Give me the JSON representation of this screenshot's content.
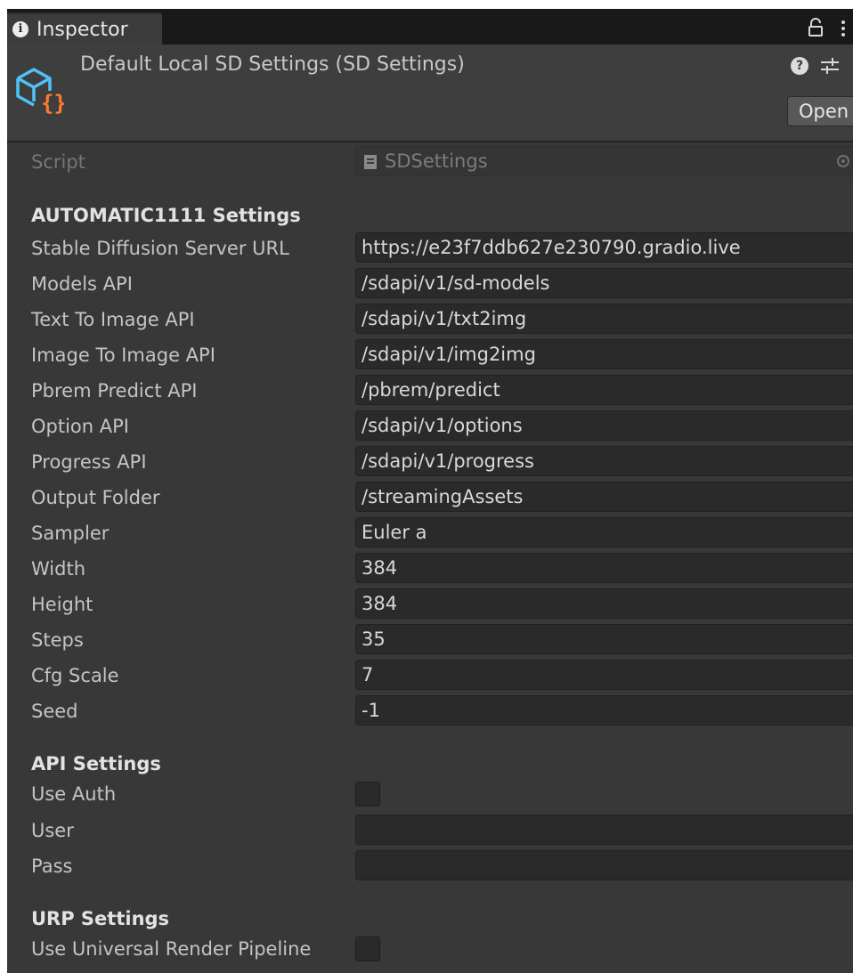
{
  "tab": {
    "title": "Inspector",
    "icon": "info-icon"
  },
  "header": {
    "title": "Default Local SD Settings (SD Settings)",
    "open_label": "Open",
    "icons": [
      "scriptable-object-icon",
      "help-icon",
      "preset-icon",
      "lock-icon",
      "kebab-menu-icon"
    ]
  },
  "script_row": {
    "label": "Script",
    "value": "SDSettings"
  },
  "automatic1111": {
    "header": "AUTOMATIC1111 Settings",
    "fields": [
      {
        "label": "Stable Diffusion Server URL",
        "value": "https://e23f7ddb627e230790.gradio.live"
      },
      {
        "label": "Models API",
        "value": "/sdapi/v1/sd-models"
      },
      {
        "label": "Text To Image API",
        "value": "/sdapi/v1/txt2img"
      },
      {
        "label": "Image To Image API",
        "value": "/sdapi/v1/img2img"
      },
      {
        "label": "Pbrem Predict API",
        "value": "/pbrem/predict"
      },
      {
        "label": "Option API",
        "value": "/sdapi/v1/options"
      },
      {
        "label": "Progress API",
        "value": "/sdapi/v1/progress"
      },
      {
        "label": "Output Folder",
        "value": "/streamingAssets"
      },
      {
        "label": "Sampler",
        "value": "Euler a"
      },
      {
        "label": "Width",
        "value": "384"
      },
      {
        "label": "Height",
        "value": "384"
      },
      {
        "label": "Steps",
        "value": "35"
      },
      {
        "label": "Cfg Scale",
        "value": "7"
      },
      {
        "label": "Seed",
        "value": "-1"
      }
    ]
  },
  "api_settings": {
    "header": "API Settings",
    "use_auth_label": "Use Auth",
    "use_auth_checked": false,
    "user_label": "User",
    "user_value": "",
    "pass_label": "Pass",
    "pass_value": ""
  },
  "urp_settings": {
    "header": "URP Settings",
    "use_urp_label": "Use Universal Render Pipeline",
    "use_urp_checked": false
  },
  "colors": {
    "panel_bg": "#383838",
    "field_bg": "#2a2a2a",
    "tabbar_bg": "#191919",
    "icon_blue": "#4fc3f7",
    "icon_orange": "#ff7a2f"
  }
}
